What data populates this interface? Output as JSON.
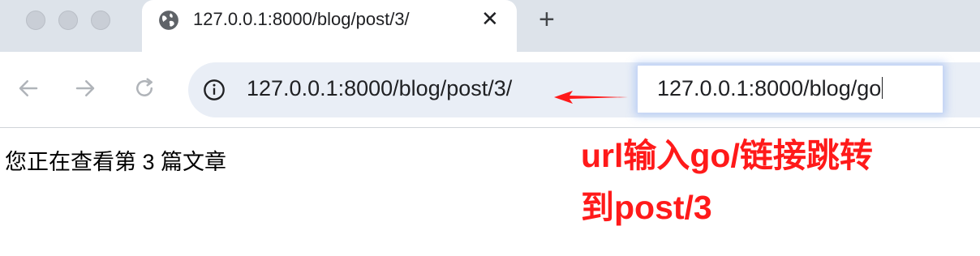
{
  "tab": {
    "title": "127.0.0.1:8000/blog/post/3/",
    "close_glyph": "✕",
    "icon": "globe-icon"
  },
  "new_tab_glyph": "+",
  "omnibox": {
    "url": "127.0.0.1:8000/blog/post/3/",
    "icon": "info-icon"
  },
  "url_edit": {
    "value": "127.0.0.1:8000/blog/go"
  },
  "page": {
    "text": "您正在查看第 3 篇文章"
  },
  "annotation": {
    "line1": "url输入go/链接跳转",
    "line2": "到post/3",
    "color": "#ff1a1a"
  },
  "colors": {
    "tabbar_bg": "#dde3ea",
    "omnibox_bg": "#e9eef6"
  }
}
